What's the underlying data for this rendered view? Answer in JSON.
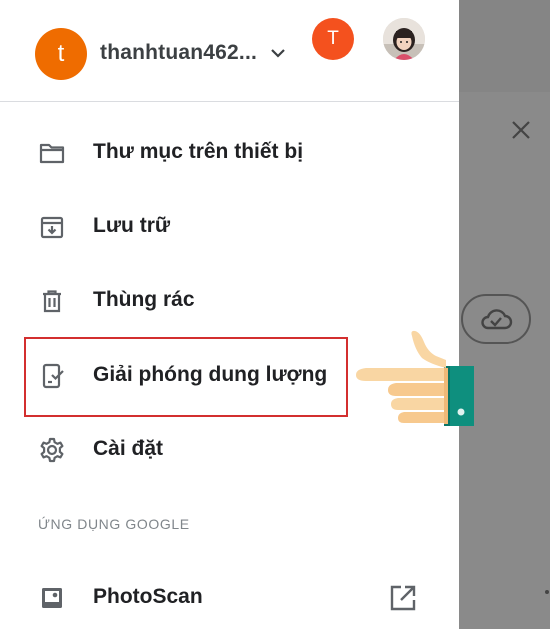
{
  "account": {
    "initial": "t",
    "name": "thanhtuan462...",
    "other_initial": "T"
  },
  "menu": [
    {
      "label": "Thư mục trên thiết bị",
      "icon": "folder-icon"
    },
    {
      "label": "Lưu trữ",
      "icon": "archive-icon"
    },
    {
      "label": "Thùng rác",
      "icon": "trash-icon"
    },
    {
      "label": "Giải phóng dung lượng",
      "icon": "free-up-space-icon"
    },
    {
      "label": "Cài đặt",
      "icon": "gear-icon"
    }
  ],
  "google_apps": {
    "header": "ỨNG DỤNG GOOGLE",
    "items": [
      {
        "label": "PhotoScan",
        "icon": "photoscan-icon"
      }
    ]
  },
  "colors": {
    "avatar_main": "#ef6c00",
    "avatar_t": "#f4511e",
    "highlight": "#d32f2f",
    "scrim": "#8a8a8a"
  }
}
